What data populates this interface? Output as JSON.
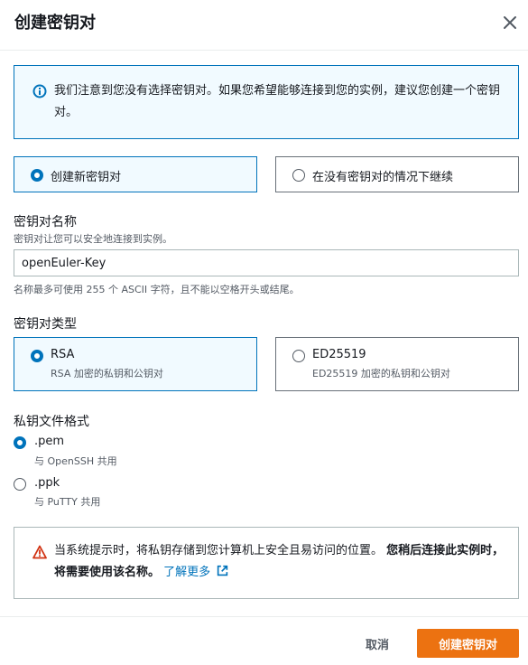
{
  "dialog": {
    "title": "创建密钥对"
  },
  "info_alert": {
    "text": "我们注意到您没有选择密钥对。如果您希望能够连接到您的实例，建议您创建一个密钥对。"
  },
  "mode_options": [
    {
      "label": "创建新密钥对",
      "selected": true
    },
    {
      "label": "在没有密钥对的情况下继续",
      "selected": false
    }
  ],
  "key_name": {
    "label": "密钥对名称",
    "description": "密钥对让您可以安全地连接到实例。",
    "value": "openEuler-Key",
    "constraint": "名称最多可使用 255 个 ASCII 字符，且不能以空格开头或结尾。"
  },
  "key_type": {
    "label": "密钥对类型",
    "options": [
      {
        "label": "RSA",
        "description": "RSA 加密的私钥和公钥对",
        "selected": true
      },
      {
        "label": "ED25519",
        "description": "ED25519 加密的私钥和公钥对",
        "selected": false
      }
    ]
  },
  "file_format": {
    "label": "私钥文件格式",
    "options": [
      {
        "label": ".pem",
        "description": "与 OpenSSH 共用",
        "selected": true
      },
      {
        "label": ".ppk",
        "description": "与 PuTTY 共用",
        "selected": false
      }
    ]
  },
  "warning_alert": {
    "text_normal": "当系统提示时，将私钥存储到您计算机上安全且易访问的位置。",
    "text_bold": "您稍后连接此实例时，将需要使用该名称。",
    "link_label": "了解更多"
  },
  "footer": {
    "cancel_label": "取消",
    "create_label": "创建密钥对"
  },
  "colors": {
    "accent": "#0073bb",
    "primary_button": "#ec7211",
    "warning": "#d13212"
  }
}
